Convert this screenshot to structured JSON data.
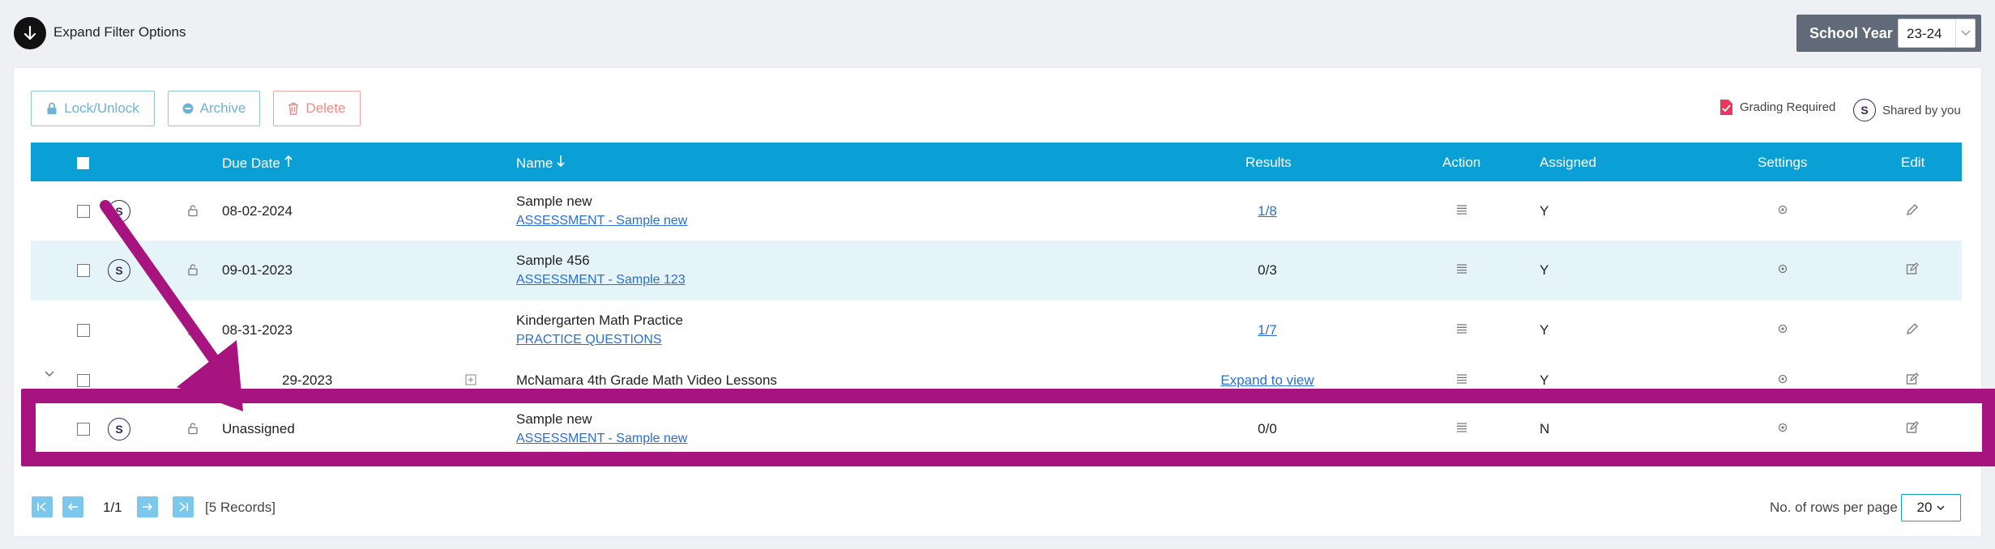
{
  "filter": {
    "expand_label": "Expand Filter Options"
  },
  "school_year": {
    "label": "School Year",
    "value": "23-24"
  },
  "toolbar": {
    "lock_label": "Lock/Unlock",
    "archive_label": "Archive",
    "delete_label": "Delete"
  },
  "legend": {
    "grading_label": "Grading Required",
    "shared_label": "Shared by you",
    "shared_badge": "S"
  },
  "table": {
    "columns": {
      "due_date": "Due Date",
      "name": "Name",
      "results": "Results",
      "action": "Action",
      "assigned": "Assigned",
      "settings": "Settings",
      "edit": "Edit"
    },
    "rows": [
      {
        "shared": "S",
        "due": "08-02-2024",
        "name": "Sample new",
        "sub": "ASSESSMENT - Sample new",
        "results": "1/8",
        "assigned": "Y"
      },
      {
        "shared": "S",
        "due": "09-01-2023",
        "name": "Sample 456",
        "sub": "ASSESSMENT - Sample 123",
        "results": "0/3",
        "assigned": "Y"
      },
      {
        "shared": "",
        "due": "08-31-2023",
        "name": "Kindergarten Math Practice",
        "sub": "PRACTICE QUESTIONS",
        "results": "1/7",
        "assigned": "Y"
      },
      {
        "shared": "",
        "due": "29-2023",
        "name": "McNamara 4th Grade Math Video Lessons",
        "sub": "",
        "results": "Expand to view",
        "assigned": "Y"
      },
      {
        "shared": "S",
        "due": "Unassigned",
        "name": "Sample new",
        "sub": "ASSESSMENT - Sample new",
        "results": "0/0",
        "assigned": "N"
      }
    ]
  },
  "pagination": {
    "page": "1/1",
    "records": "[5 Records]",
    "rows_label": "No. of rows per page",
    "rows_value": "20"
  },
  "colors": {
    "header": "#0aa0d6",
    "highlight": "#a8147f",
    "link": "#2a6fd1"
  }
}
